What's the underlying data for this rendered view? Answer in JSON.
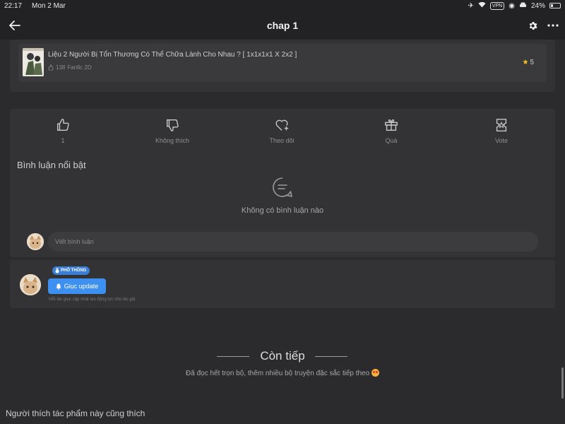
{
  "status_bar": {
    "time": "22:17",
    "date": "Mon 2 Mar",
    "vpn": "VPN",
    "battery": "24%"
  },
  "nav": {
    "title": "chap 1"
  },
  "book": {
    "title": "Liệu 2 Người Bị Tổn Thương Có Thể Chữa Lành Cho Nhau ? [ 1x1x1x1 X 2x2 ]",
    "views": "138",
    "category": "Fanfic 2D",
    "rating": "5"
  },
  "reactions": {
    "like_count": "1",
    "dislike_label": "Không thích",
    "follow_label": "Theo dõi",
    "gift_label": "Quà",
    "vote_label": "Vote"
  },
  "comments": {
    "heading": "Bình luận nổi bật",
    "empty_text": "Không có bình luận nào",
    "input_placeholder": "Viết bình luận"
  },
  "update": {
    "tier_badge": "PHỔ THÔNG",
    "button_label": "Giục update",
    "note": "Mỗi lần giục cập nhật tạo động lực cho tác giả"
  },
  "continue": {
    "title": "Còn tiếp",
    "subtitle": "Đã đọc hết trọn bộ, thêm nhiều bộ truyện đặc sắc tiếp theo"
  },
  "recommend": {
    "heading": "Người thích tác phẩm này cũng thích"
  },
  "colors": {
    "background": "#2b2b2d",
    "card": "#333336",
    "accent_blue": "#3d8ff0",
    "star": "#f5c518"
  }
}
